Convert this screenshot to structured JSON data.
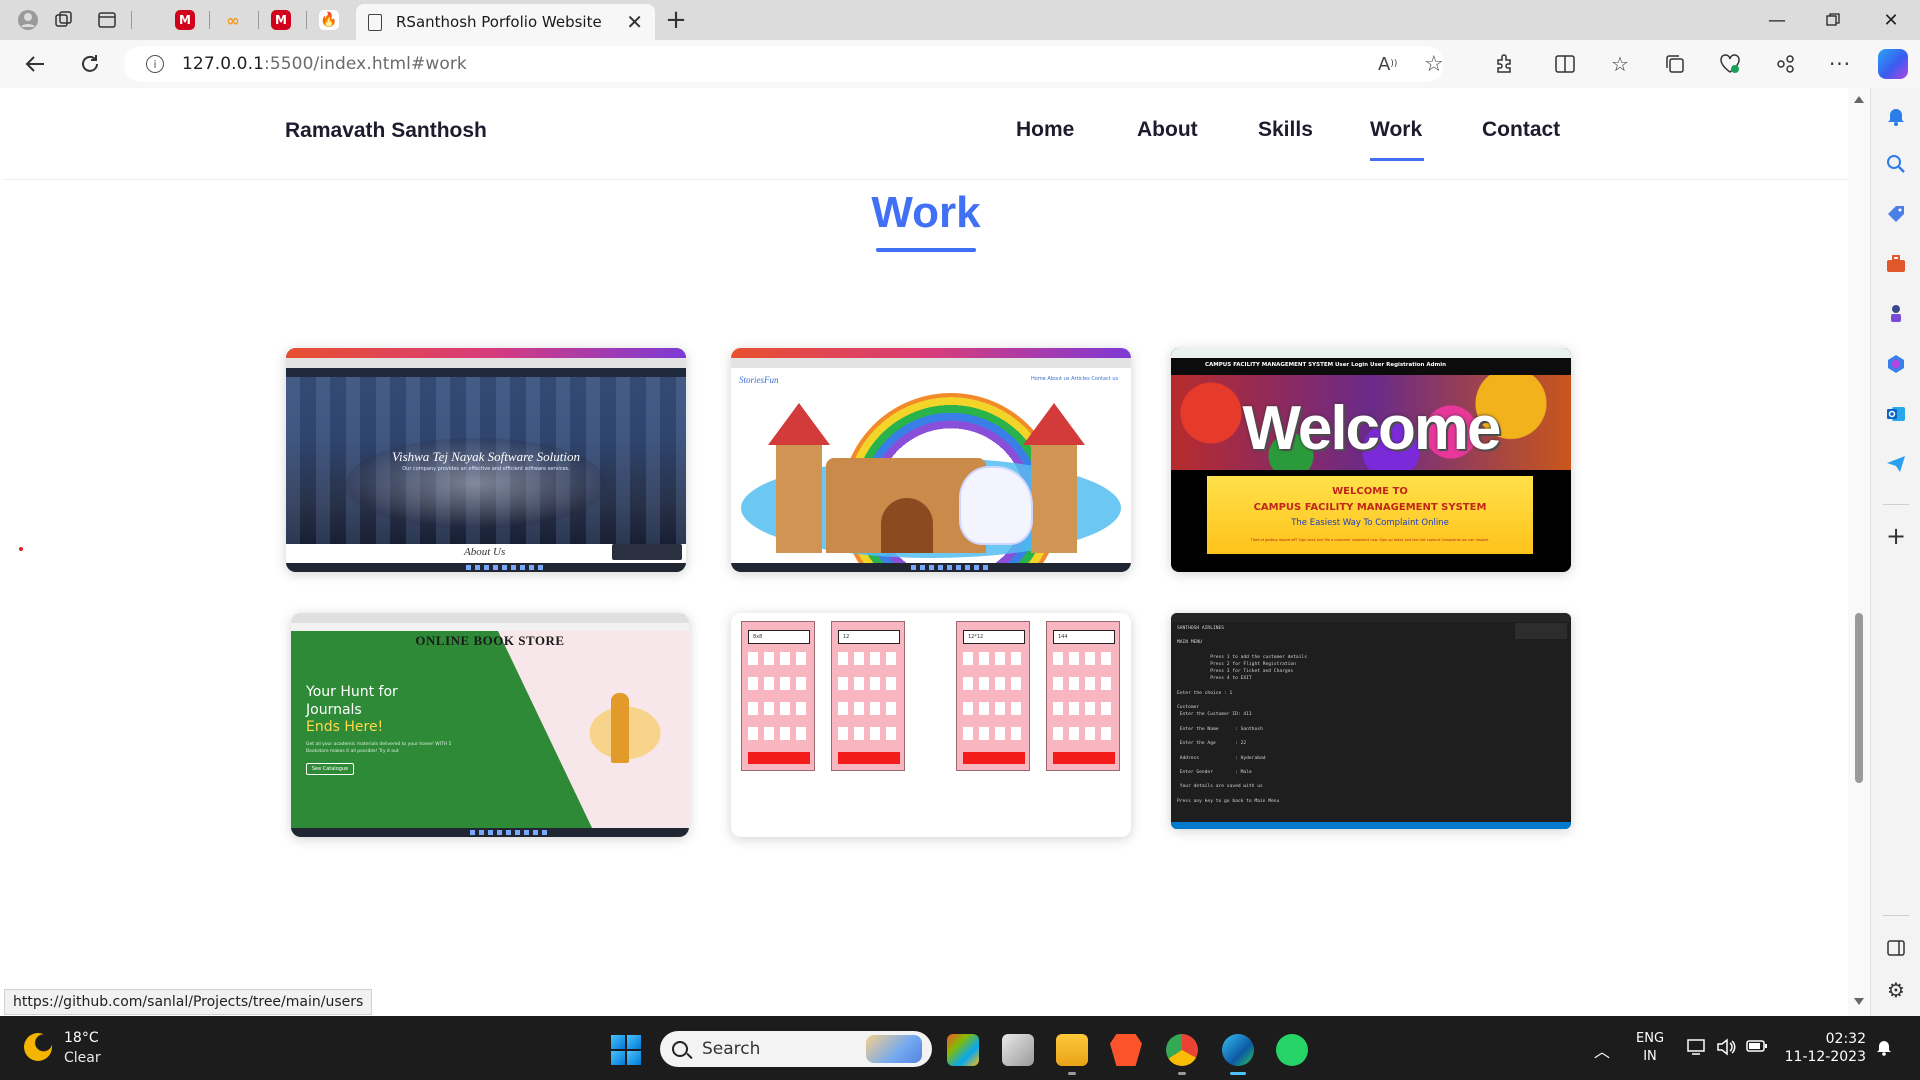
{
  "browser": {
    "active_tab_title": "RSanthosh Porfolio Website",
    "url_host": "127.0.0.1",
    "url_rest": ":5500/index.html#work",
    "status_link": "https://github.com/sanlal/Projects/tree/main/users",
    "accent": "#4070f4"
  },
  "site": {
    "brand": "Ramavath Santhosh",
    "nav": [
      "Home",
      "About",
      "Skills",
      "Work",
      "Contact"
    ],
    "active_nav": "Work",
    "section_title": "Work"
  },
  "projects": {
    "p1": {
      "headline": "Vishwa Tej Nayak Software Solution",
      "tagline": "Our company provides an effective and efficient software services.",
      "about": "About Us"
    },
    "p2": {
      "logo": "StoriesFun",
      "menu": "Home  About us  Articles  Contact us"
    },
    "p3": {
      "nav": "CAMPUS FACILITY MANAGEMENT SYSTEM     User Login     User Registration     Admin",
      "banner": "Welcome",
      "line1": "WELCOME TO",
      "line2": "CAMPUS FACILITY MANAGEMENT SYSTEM",
      "line3": "The Easiest Way To Complaint Online",
      "line4": "Tired of getting ripped off? Sign back and file a customer complaint now. Sign up today and the Get Lawsuit Complaints we can resolve."
    },
    "p4": {
      "title": "ONLINE BOOK STORE",
      "hunt": "Your Hunt for\nJournals",
      "ends": "Ends Here!",
      "desc": "Get all your academic materials delivered to your home! WITH 5 Bookstore makes it all possible! Try it out",
      "button": "See Catalogue"
    },
    "p5": {
      "displays": [
        "8x8",
        "12",
        "12*12",
        "144"
      ]
    },
    "p6": {
      "terminal": "SANTHOSH AIRLINES\n\nMAIN MENU\n\n            Press 1 to add the customer details\n            Press 2 for Flight Registration\n            Press 3 for Ticket and Charges\n            Press 4 to EXIT\n\nEnter the choice : 1\n\nCustomer\n Enter the Customer ID: 411\n\n Enter the Name      : Santhosh\n\n Enter the Age       : 22\n\n Address             : Hyderabad\n\n Enter Gender        : Male\n\n Your details are saved with us\n\nPress any key to go back to Main Menu"
    }
  },
  "taskbar": {
    "temp": "18°C",
    "weather": "Clear",
    "search": "Search",
    "lang1": "ENG",
    "lang2": "IN",
    "time": "02:32",
    "date": "11-12-2023"
  }
}
